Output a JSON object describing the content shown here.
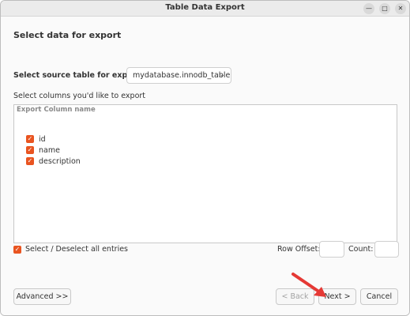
{
  "window": {
    "title": "Table Data Export"
  },
  "page": {
    "title": "Select data for export"
  },
  "source": {
    "label": "Select source table for export:",
    "selected": "mydatabase.innodb_table"
  },
  "columns": {
    "label": "Select columns you'd like to export",
    "header_export": "Export",
    "header_name": "Column name",
    "items": [
      {
        "name": "id",
        "checked": true
      },
      {
        "name": "name",
        "checked": true
      },
      {
        "name": "description",
        "checked": true
      }
    ]
  },
  "select_all": {
    "label": "Select / Deselect all entries",
    "checked": true
  },
  "row_offset": {
    "label": "Row Offset:",
    "value": ""
  },
  "count": {
    "label": "Count:",
    "value": ""
  },
  "buttons": {
    "advanced": "Advanced >>",
    "back": "< Back",
    "next": "Next >",
    "cancel": "Cancel"
  },
  "colors": {
    "accent": "#e95420",
    "annotation_arrow": "#e53935"
  }
}
